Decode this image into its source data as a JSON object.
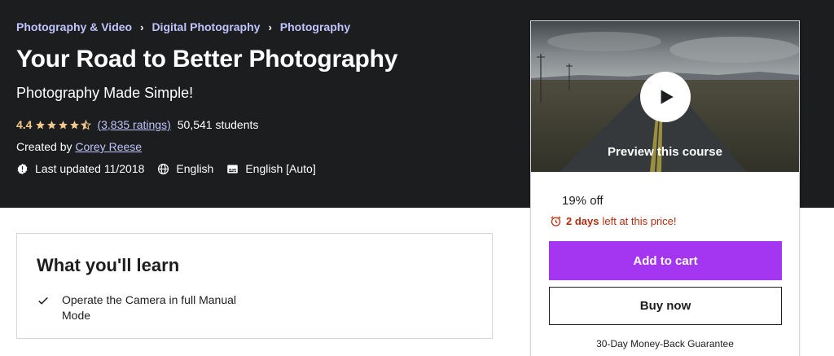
{
  "breadcrumb": [
    "Photography & Video",
    "Digital Photography",
    "Photography"
  ],
  "course": {
    "title": "Your Road to Better Photography",
    "subtitle": "Photography Made Simple!",
    "rating": "4.4",
    "stars": 4.4,
    "ratings_count": "(3,835 ratings)",
    "students": "50,541 students",
    "created_by_label": "Created by",
    "author": "Corey Reese",
    "last_updated": "Last updated 11/2018",
    "language": "English",
    "captions": "English [Auto]"
  },
  "learn": {
    "title": "What you'll learn",
    "items": [
      "Operate the Camera in full Manual Mode"
    ]
  },
  "sidebar": {
    "preview_label": "Preview this course",
    "discount": "19% off",
    "timer_days": "2 days",
    "timer_text": "left at this price!",
    "add_to_cart": "Add to cart",
    "buy_now": "Buy now",
    "guarantee": "30-Day Money-Back Guarantee"
  },
  "colors": {
    "hero_bg": "#1c1d1f",
    "link": "#c0c4fc",
    "star": "#f3ca8c",
    "accent": "#a435f0",
    "alert": "#b32d0f"
  },
  "icons": [
    "chevron-right-icon",
    "star-icon",
    "alert-badge-icon",
    "globe-icon",
    "captions-icon",
    "check-icon",
    "play-icon",
    "alarm-clock-icon"
  ]
}
